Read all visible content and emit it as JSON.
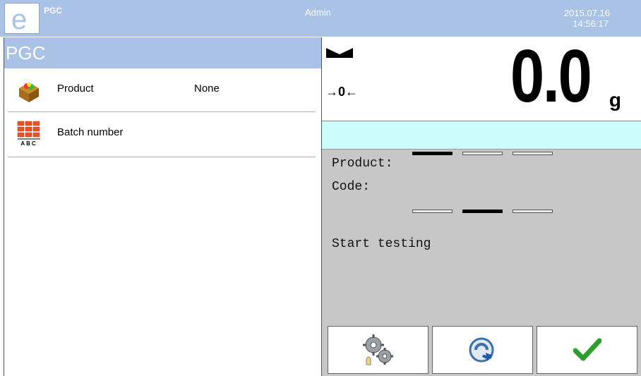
{
  "topbar": {
    "app_name": "PGC",
    "user": "Admin",
    "date": "2015.07.16",
    "time": "14:56:17",
    "logo_letter": "e"
  },
  "left": {
    "title": "PGC",
    "items": [
      {
        "label": "Product",
        "value": "None",
        "icon": "product-box-icon"
      },
      {
        "label": "Batch number",
        "value": "",
        "icon": "batch-number-icon",
        "icon_caption": "ABC"
      }
    ]
  },
  "weighing": {
    "value": "0.0",
    "unit": "g",
    "zero_label": "→0←",
    "stable": true
  },
  "work": {
    "product_label": "Product:",
    "code_label": "Code:",
    "message": "Start testing",
    "progress_top": [
      true,
      false,
      false
    ],
    "progress_bottom": [
      false,
      true,
      false
    ]
  },
  "buttons": [
    {
      "name": "settings-button",
      "icon": "gears-icon"
    },
    {
      "name": "return-button",
      "icon": "return-arrow-icon"
    },
    {
      "name": "confirm-button",
      "icon": "check-icon"
    }
  ],
  "colors": {
    "topbar": "#a9c2e6",
    "info_strip": "#ccfcfc",
    "work_area": "#c7c7c7",
    "check_green": "#2e9e2e"
  }
}
